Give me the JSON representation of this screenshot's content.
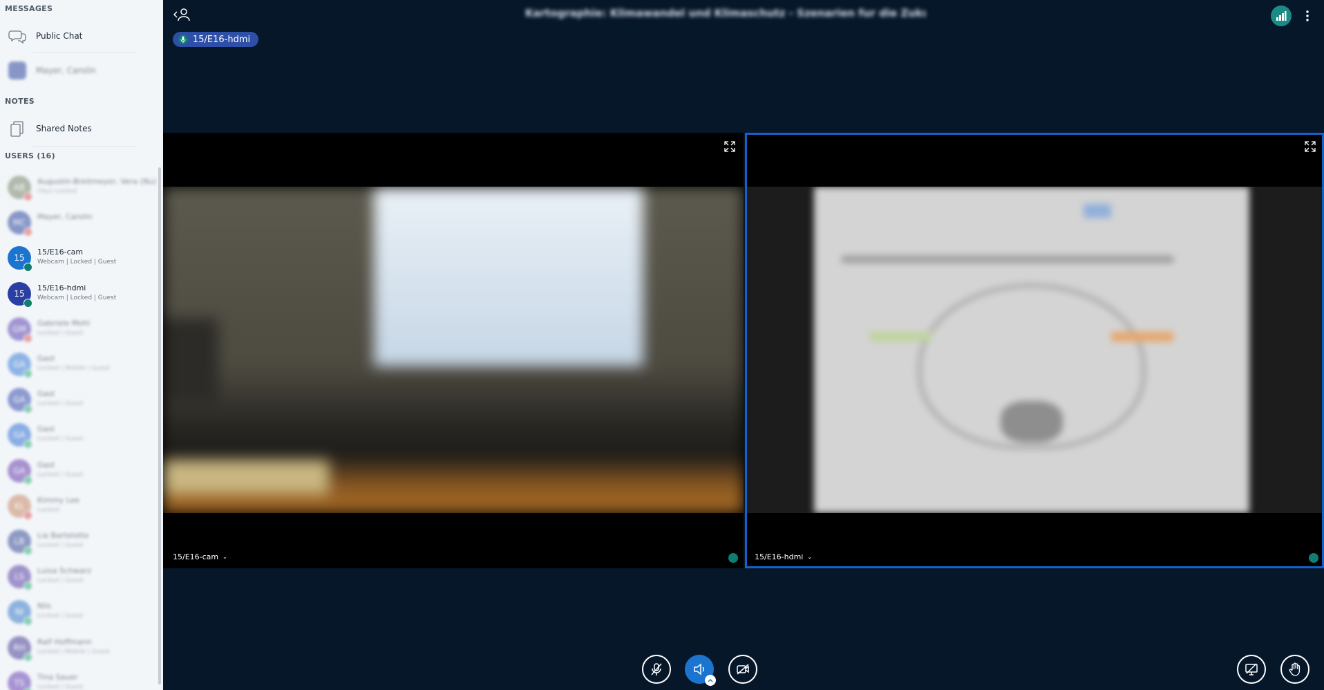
{
  "sidebar": {
    "messages_title": "MESSAGES",
    "public_chat": "Public Chat",
    "private_chat_user": "Mayer, Carolin",
    "notes_title": "NOTES",
    "shared_notes": "Shared Notes",
    "users_title": "USERS (16)",
    "users": [
      {
        "name": "Augustin-Breitmeyer, Vera (Nu)",
        "sub": "(You) Locked",
        "initials": "AB",
        "color": "#7B8A6E",
        "badge": "#E05A5A",
        "blur": true
      },
      {
        "name": "Mayer, Carolin",
        "sub": "",
        "initials": "MC",
        "color": "#2F49A0",
        "badge": "#E05A5A",
        "blur": true
      },
      {
        "name": "15/E16-cam",
        "sub": "Webcam | Locked | Guest",
        "initials": "15",
        "color": "#1B75D0",
        "badge": "#0F7E71",
        "blur": false
      },
      {
        "name": "15/E16-hdmi",
        "sub": "Webcam | Locked | Guest",
        "initials": "15",
        "color": "#2B3FA3",
        "badge": "#0F7E71",
        "blur": false
      },
      {
        "name": "Gabriele Mohl",
        "sub": "Locked | Guest",
        "initials": "GM",
        "color": "#5C46B4",
        "badge": "#E05A5A",
        "blur": true
      },
      {
        "name": "Gast",
        "sub": "Locked | Mobile | Guest",
        "initials": "GA",
        "color": "#3D7FD6",
        "badge": "#2FAE7A",
        "blur": true
      },
      {
        "name": "Gast",
        "sub": "Locked | Guest",
        "initials": "GA",
        "color": "#3A4FB0",
        "badge": "#2FAE7A",
        "blur": true
      },
      {
        "name": "Gast",
        "sub": "Locked | Guest",
        "initials": "GA",
        "color": "#3572D4",
        "badge": "#2FAE7A",
        "blur": true
      },
      {
        "name": "Gast",
        "sub": "Locked | Guest",
        "initials": "GA",
        "color": "#6B3FB0",
        "badge": "#2FAE7A",
        "blur": true
      },
      {
        "name": "Kimmy Lee",
        "sub": "Locked",
        "initials": "KL",
        "color": "#C98A6A",
        "badge": "#E05A5A",
        "blur": true
      },
      {
        "name": "Lia Bartelotte",
        "sub": "Locked | Guest",
        "initials": "LB",
        "color": "#3B4F9A",
        "badge": "#2FAE7A",
        "blur": true
      },
      {
        "name": "Luisa Schwarz",
        "sub": "Locked | Guest",
        "initials": "LS",
        "color": "#5A43A8",
        "badge": "#2FAE7A",
        "blur": true
      },
      {
        "name": "Nils",
        "sub": "Locked | Guest",
        "initials": "NI",
        "color": "#3A7CC9",
        "badge": "#2FAE7A",
        "blur": true
      },
      {
        "name": "Ralf Hoffmann",
        "sub": "Locked | Mobile | Guest",
        "initials": "RH",
        "color": "#4B3F98",
        "badge": "#2FAE7A",
        "blur": true
      },
      {
        "name": "Tina Sauer",
        "sub": "Locked | Guest",
        "initials": "TS",
        "color": "#6A44B3",
        "badge": "#2FAE7A",
        "blur": true
      }
    ]
  },
  "header": {
    "meeting_title": "Kartographie: Klimawandel und Klimaschutz - Szenarien fur die Zukunft - Klimawandel a...",
    "talking_indicator": "15/E16-hdmi"
  },
  "videos": {
    "cam_label": "15/E16-cam",
    "hdmi_label": "15/E16-hdmi"
  },
  "icons": {
    "back": "user-back-icon",
    "connection": "signal-icon",
    "more": "more-vert-icon",
    "mic": "mic-muted-icon",
    "audio": "speaker-icon",
    "camera": "camera-off-icon",
    "screenshare": "screenshare-off-icon",
    "raise_hand": "hand-icon"
  },
  "colors": {
    "background": "#06172A",
    "accent": "#1B75D0",
    "selected_border": "#1660C9",
    "connection_ok": "#1B8C85"
  }
}
